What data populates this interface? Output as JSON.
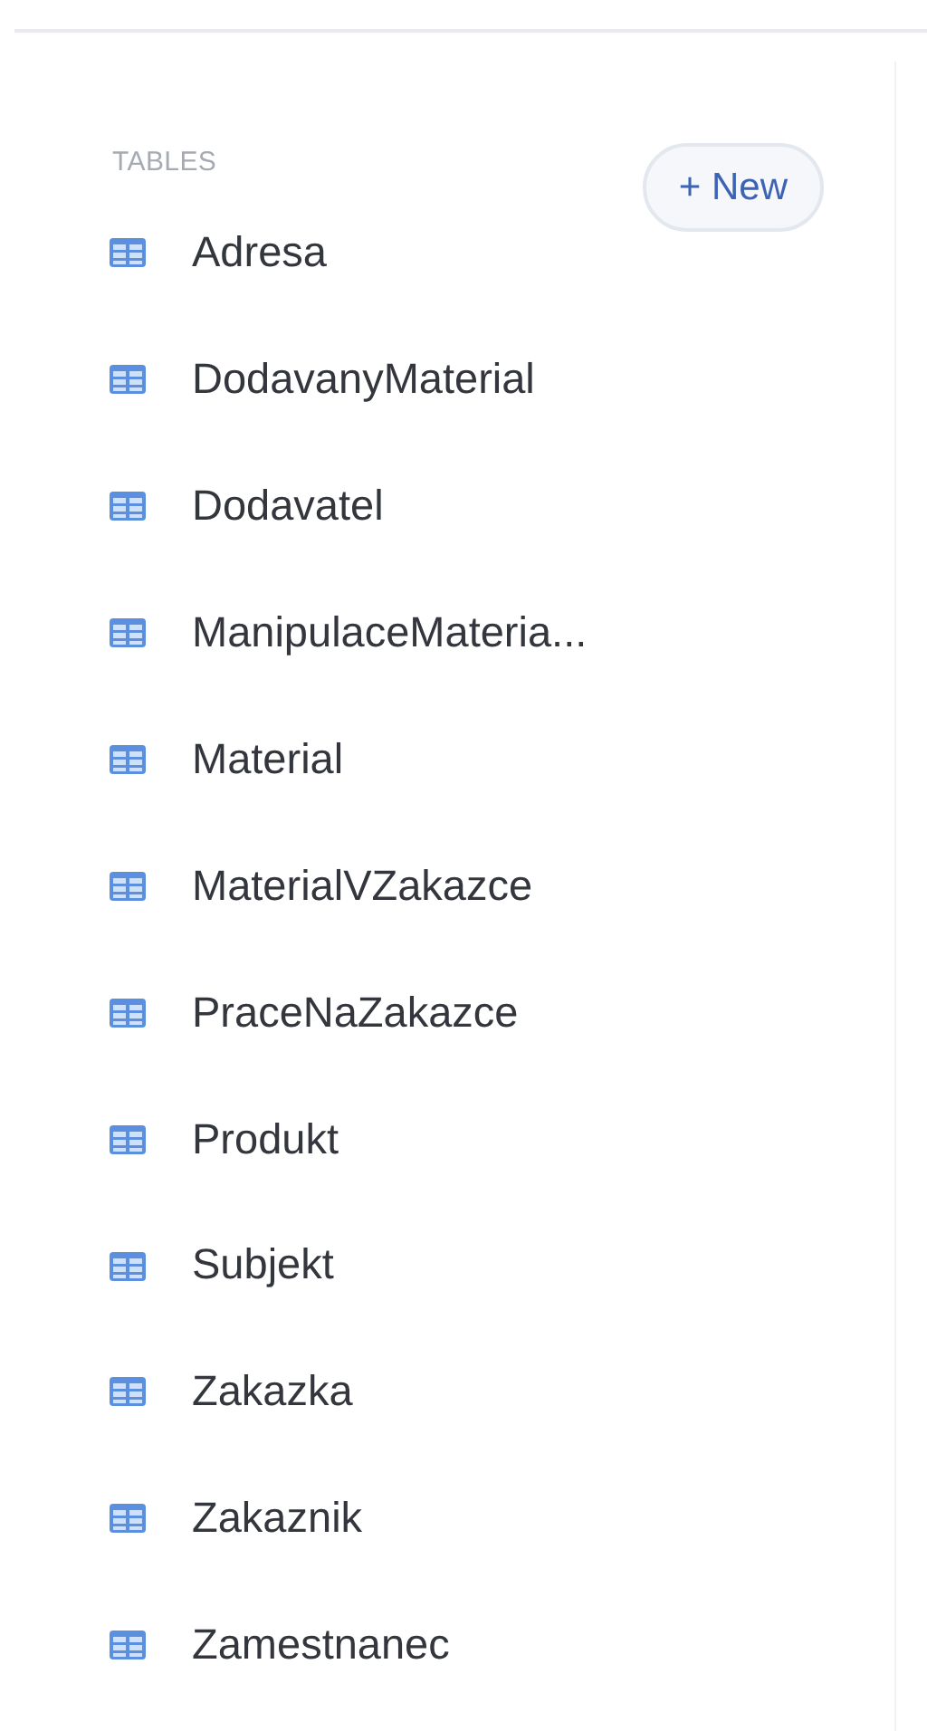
{
  "section": {
    "title": "TABLES",
    "new_button": "+ New"
  },
  "tables": [
    {
      "name": "Adresa"
    },
    {
      "name": "DodavanyMaterial"
    },
    {
      "name": "Dodavatel"
    },
    {
      "name": "ManipulaceMateria..."
    },
    {
      "name": "Material"
    },
    {
      "name": "MaterialVZakazce"
    },
    {
      "name": "PraceNaZakazce"
    },
    {
      "name": "Produkt"
    },
    {
      "name": "Subjekt"
    },
    {
      "name": "Zakazka"
    },
    {
      "name": "Zakaznik"
    },
    {
      "name": "Zamestnanec"
    }
  ]
}
